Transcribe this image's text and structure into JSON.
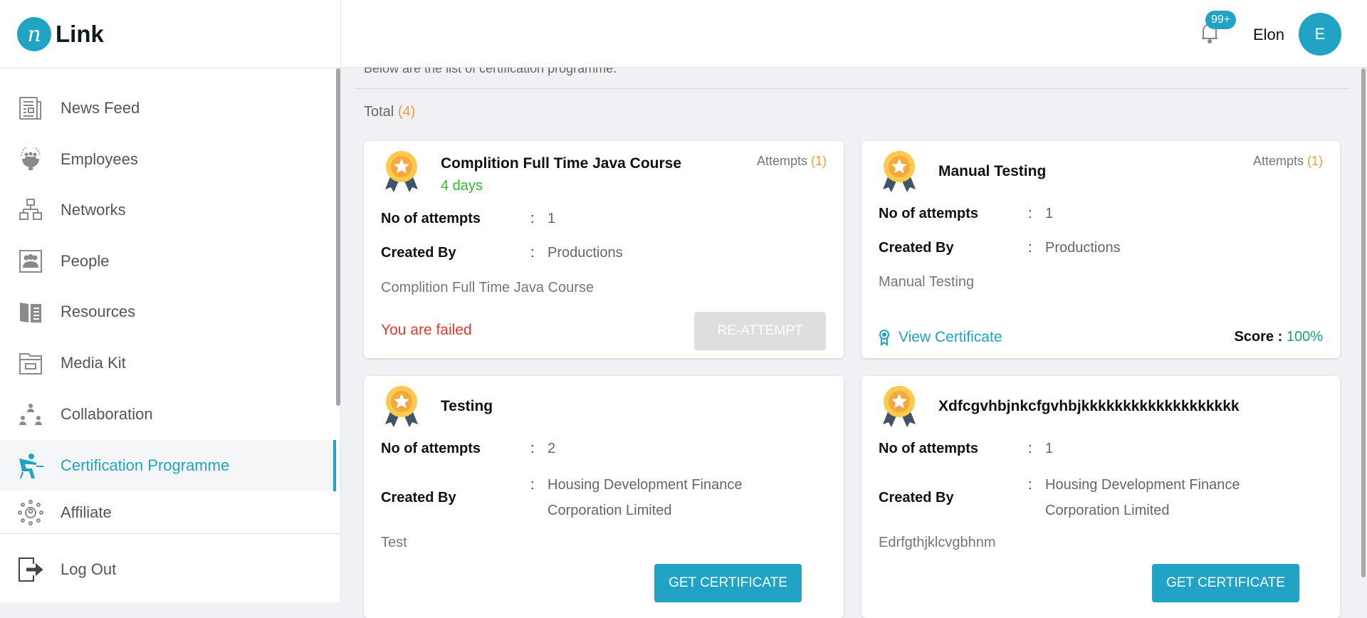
{
  "brand": {
    "logo_letter": "n",
    "name": "Link"
  },
  "sidebar": {
    "items": [
      {
        "label": "News Feed",
        "icon": "newspaper-icon"
      },
      {
        "label": "Employees",
        "icon": "employees-gear-icon"
      },
      {
        "label": "Networks",
        "icon": "network-icon"
      },
      {
        "label": "People",
        "icon": "people-icon"
      },
      {
        "label": "Resources",
        "icon": "book-icon"
      },
      {
        "label": "Media Kit",
        "icon": "folder-icon"
      },
      {
        "label": "Collaboration",
        "icon": "collaboration-icon"
      },
      {
        "label": "Certification Programme",
        "icon": "certification-icon",
        "active": true
      },
      {
        "label": "Affiliate",
        "icon": "affiliate-icon"
      }
    ],
    "logout": "Log Out"
  },
  "header": {
    "badge": "99+",
    "user": "Elon",
    "avatar": "E"
  },
  "main": {
    "subtitle": "Below are the list of certification programme.",
    "total_label": "Total",
    "total_count": "(4)",
    "labels": {
      "attempts": "Attempts",
      "no_of_attempts": "No of attempts",
      "created_by": "Created By",
      "colon": ":",
      "score": "Score :"
    },
    "cards": [
      {
        "title": "Complition Full Time Java Course",
        "duration": "4 days",
        "attempts": "(1)",
        "no_of_attempts": "1",
        "created_by": "Productions",
        "description": "Complition Full Time Java Course",
        "status": "You are failed",
        "button": "RE-ATTEMPT"
      },
      {
        "title": "Manual Testing",
        "attempts": "(1)",
        "no_of_attempts": "1",
        "created_by": "Productions",
        "description": "Manual Testing",
        "link": "View Certificate",
        "score": "100%"
      },
      {
        "title": "Testing",
        "no_of_attempts": "2",
        "created_by": "Housing Development Finance Corporation Limited",
        "description": "Test",
        "button": "GET CERTIFICATE"
      },
      {
        "title": "Xdfcgvhbjnkcfgvhbjkkkkkkkkkkkkkkkkkkk",
        "no_of_attempts": "1",
        "created_by": "Housing Development Finance Corporation Limited",
        "description": "Edrfgthjklcvgbhnm",
        "button": "GET CERTIFICATE"
      }
    ]
  },
  "colors": {
    "accent": "#21a3c6",
    "orange": "#f39a3c",
    "green": "#2dbb2d",
    "red": "#e03a2f",
    "score": "#14a085"
  }
}
